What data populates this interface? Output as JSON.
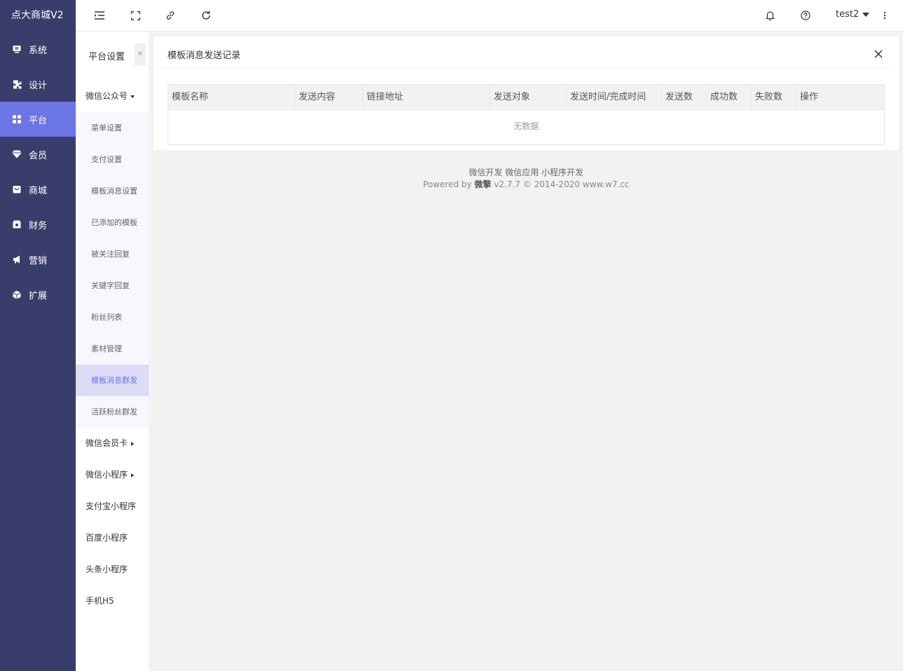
{
  "app": {
    "title": "点大商城V2"
  },
  "sidebar": {
    "items": [
      {
        "label": "系统",
        "icon": "monitor-icon",
        "active": false
      },
      {
        "label": "设计",
        "icon": "puzzle-icon",
        "active": false
      },
      {
        "label": "平台",
        "icon": "grid-icon",
        "active": true
      },
      {
        "label": "会员",
        "icon": "diamond-icon",
        "active": false
      },
      {
        "label": "商城",
        "icon": "bag-icon",
        "active": false
      },
      {
        "label": "财务",
        "icon": "wallet-icon",
        "active": false
      },
      {
        "label": "营销",
        "icon": "megaphone-icon",
        "active": false
      },
      {
        "label": "扩展",
        "icon": "cube-icon",
        "active": false
      }
    ]
  },
  "topbar": {
    "icons": [
      "menu-fold-icon",
      "fullscreen-icon",
      "link-icon",
      "refresh-icon",
      "bell-icon",
      "help-icon",
      "more-icon"
    ],
    "user": "test2"
  },
  "submenu": {
    "title": "平台设置",
    "collapse_glyph": "«",
    "group_wechat": "微信公众号",
    "wechat_items": [
      "菜单设置",
      "支付设置",
      "模板消息设置",
      "已添加的模板",
      "被关注回复",
      "关键字回复",
      "粉丝列表",
      "素材管理",
      "模板消息群发",
      "活跃粉丝群发"
    ],
    "active_item": "模板消息群发",
    "groups": [
      "微信会员卡",
      "微信小程序",
      "支付宝小程序",
      "百度小程序",
      "头条小程序",
      "手机H5"
    ]
  },
  "main": {
    "title": "模板消息发送记录",
    "columns": [
      "模板名称",
      "发送内容",
      "链接地址",
      "发送对象",
      "发送时间/完成时间",
      "发送数",
      "成功数",
      "失败数",
      "操作"
    ],
    "empty_text": "无数据"
  },
  "footer": {
    "links": "微信开发 微信应用 小程序开发",
    "powered_prefix": "Powered by ",
    "brand": "微擎",
    "powered_suffix": " v2.7.7 © 2014-2020 www.w7.cc"
  },
  "colors": {
    "sidebar": "#393d6b",
    "accent": "#6b75e6",
    "submenu_active_bg": "#dcdcf7"
  }
}
